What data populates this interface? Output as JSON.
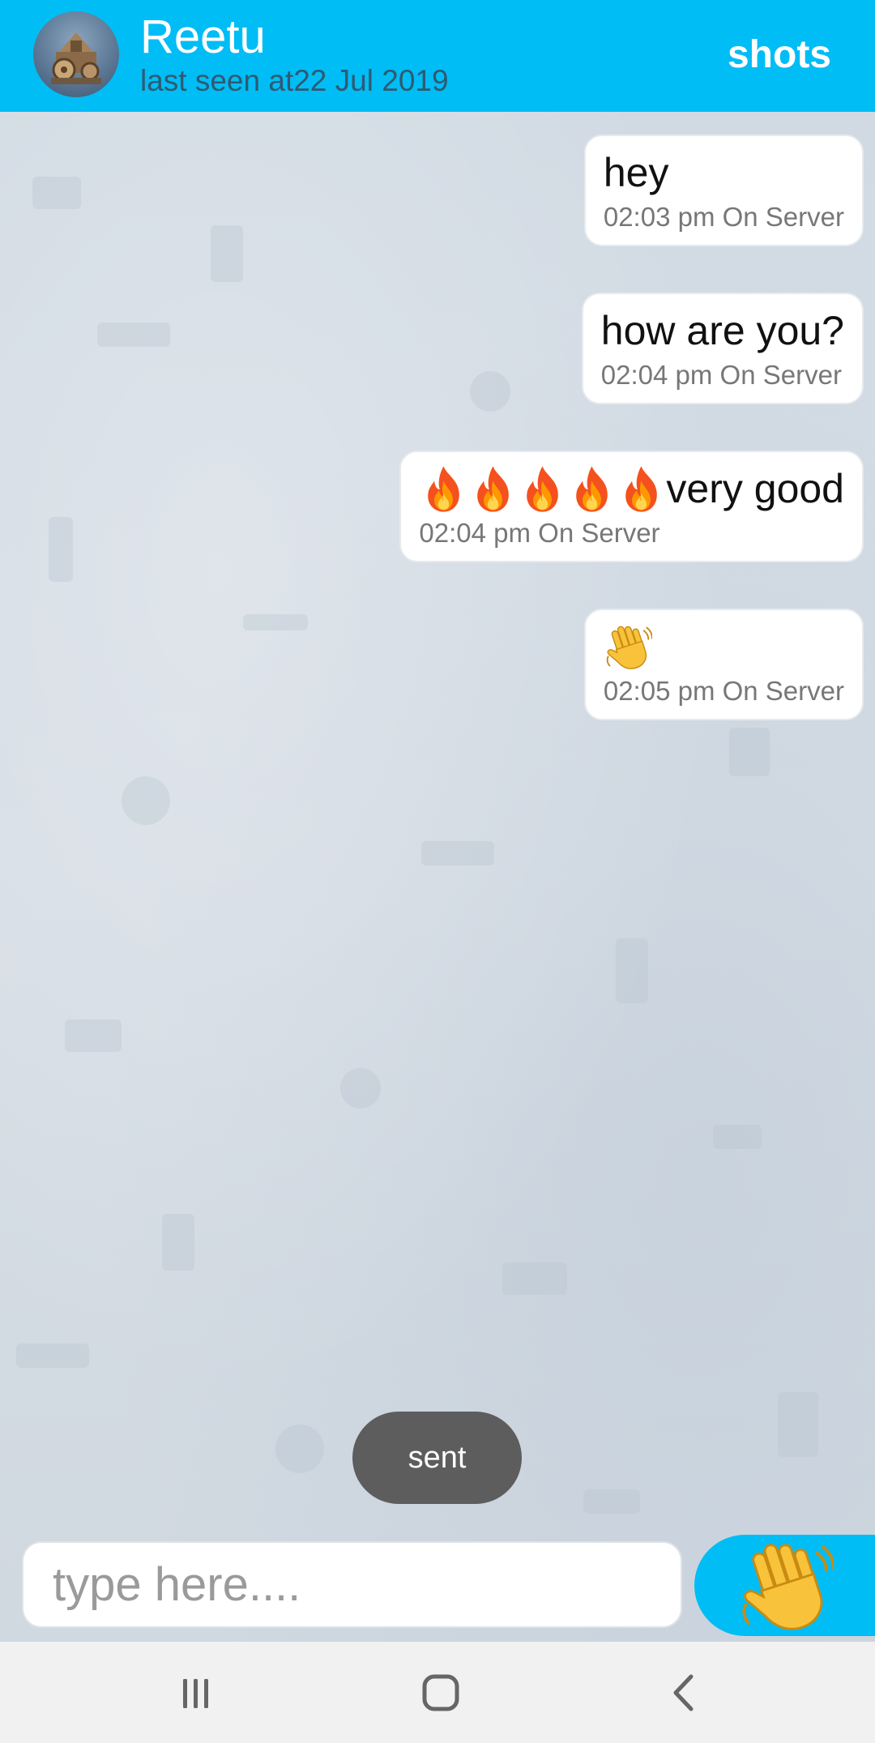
{
  "header": {
    "contact_name": "Reetu",
    "last_seen": "last seen at22 Jul 2019",
    "shots_label": "shots",
    "bg_color": "#00bdf5"
  },
  "messages": [
    {
      "text": "hey",
      "meta": "02:03 pm On Server"
    },
    {
      "text": "how are you?",
      "meta": "02:04 pm On Server"
    },
    {
      "emoji_prefix": [
        "fire-icon",
        "fire-icon",
        "fire-icon",
        "fire-icon",
        "fire-icon"
      ],
      "text": "very good",
      "meta": "02:04 pm On Server"
    },
    {
      "emoji": "waving-hand-icon",
      "meta": "02:05 pm On Server"
    }
  ],
  "toast": {
    "text": "sent"
  },
  "composer": {
    "placeholder": "type here....",
    "value": "",
    "send_icon": "waving-hand-icon"
  },
  "navbar": {
    "recents_icon": "recents-icon",
    "home_icon": "home-icon",
    "back_icon": "back-icon"
  }
}
